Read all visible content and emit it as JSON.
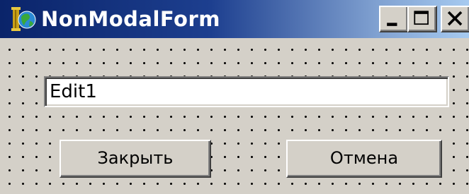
{
  "window": {
    "title": "NonModalForm",
    "icon": "delphi-app-icon",
    "controls": {
      "minimize_icon": "minimize-icon",
      "maximize_icon": "maximize-icon",
      "close_icon": "close-icon"
    }
  },
  "form": {
    "edit": {
      "value": "Edit1"
    },
    "buttons": {
      "close_label": "Закрыть",
      "cancel_label": "Отмена"
    }
  },
  "colors": {
    "titlebar_start": "#0a246a",
    "titlebar_end": "#a6caf0",
    "face": "#d4d0c8",
    "grid_dot": "#000000"
  }
}
